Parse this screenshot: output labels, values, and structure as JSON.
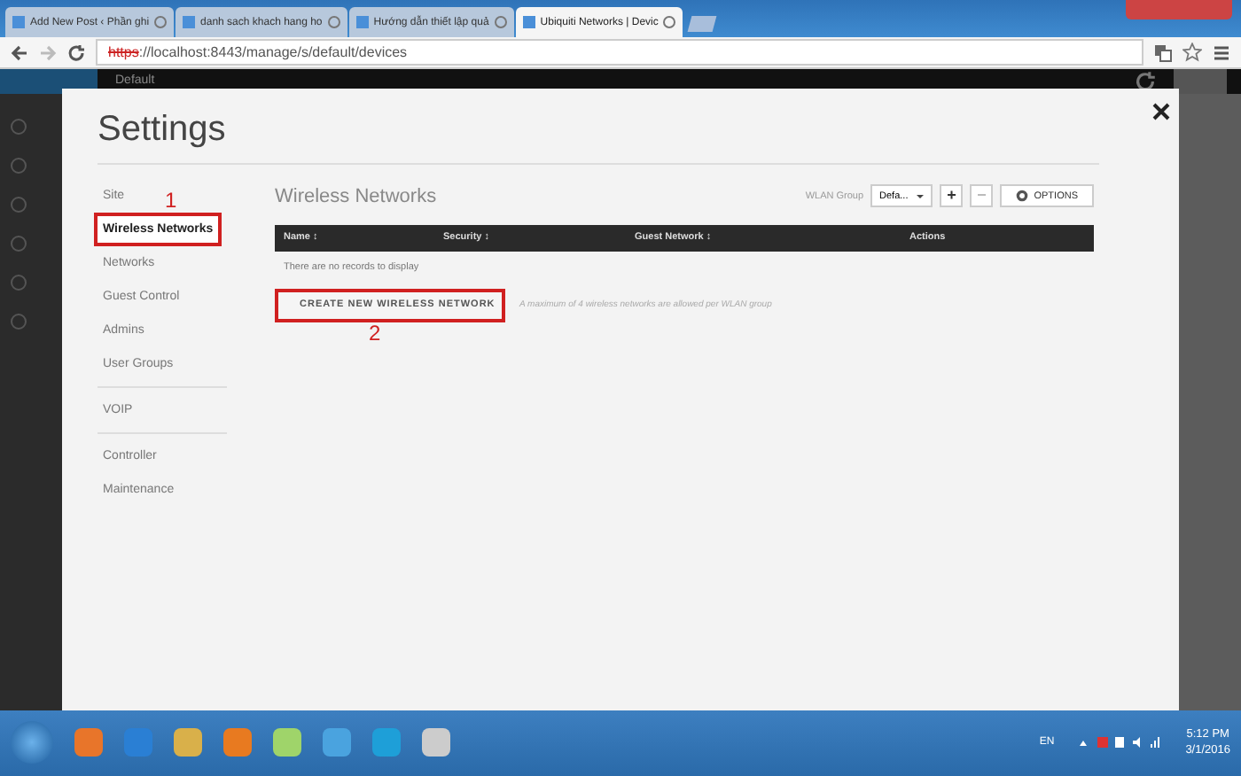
{
  "browser": {
    "tabs": [
      {
        "label": "Add New Post ‹ Phần ghi",
        "selected": false
      },
      {
        "label": "danh sach khach hang ho",
        "selected": false
      },
      {
        "label": "Hướng dẫn thiết lập quả",
        "selected": false
      },
      {
        "label": "Ubiquiti Networks | Devic",
        "selected": true
      }
    ],
    "url_scheme": "https",
    "url_rest": "://localhost:8443/manage/s/default/devices"
  },
  "app_header": {
    "site": "Default"
  },
  "settings": {
    "title": "Settings",
    "nav_groups": [
      [
        {
          "label": "Site",
          "selected": false
        },
        {
          "label": "Wireless Networks",
          "selected": true,
          "annotation": "1"
        },
        {
          "label": "Networks",
          "selected": false
        },
        {
          "label": "Guest Control",
          "selected": false
        },
        {
          "label": "Admins",
          "selected": false
        },
        {
          "label": "User Groups",
          "selected": false
        }
      ],
      [
        {
          "label": "VOIP",
          "selected": false
        }
      ],
      [
        {
          "label": "Controller",
          "selected": false
        },
        {
          "label": "Maintenance",
          "selected": false
        }
      ]
    ],
    "section_title": "Wireless Networks",
    "wlan_group_label": "WLAN Group",
    "wlan_group_value": "Defa...",
    "add_button": "+",
    "remove_button": "−",
    "remove_disabled": true,
    "options_button": "OPTIONS",
    "columns": [
      "Name ↕",
      "Security ↕",
      "Guest Network ↕",
      "Actions"
    ],
    "empty_message": "There are no records to display",
    "create_button": "CREATE NEW WIRELESS NETWORK",
    "create_annotation": "2",
    "hint": "A maximum of 4 wireless networks are allowed per WLAN group"
  },
  "taskbar": {
    "language": "EN",
    "time": "5:12 PM",
    "date": "3/1/2016"
  }
}
